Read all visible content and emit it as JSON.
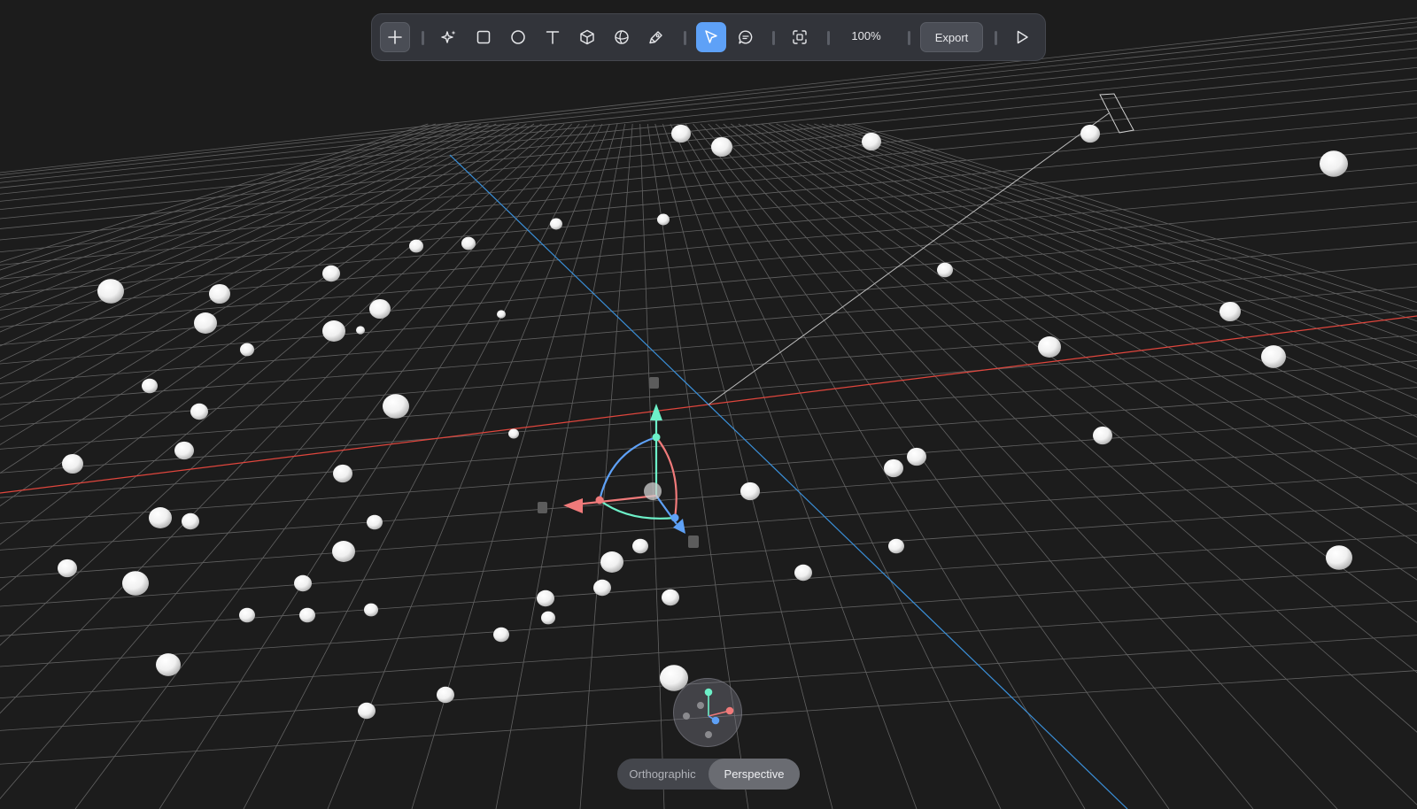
{
  "toolbar": {
    "tools": [
      {
        "name": "add",
        "icon": "plus-icon"
      },
      {
        "name": "ai-generate",
        "icon": "sparkles-icon"
      },
      {
        "name": "rectangle",
        "icon": "square-icon"
      },
      {
        "name": "ellipse",
        "icon": "circle-icon"
      },
      {
        "name": "text",
        "icon": "text-icon"
      },
      {
        "name": "cube",
        "icon": "cube-icon"
      },
      {
        "name": "sphere",
        "icon": "sphere-icon"
      },
      {
        "name": "pen",
        "icon": "pen-icon"
      },
      {
        "name": "select",
        "icon": "cursor-icon",
        "active": true
      },
      {
        "name": "comment",
        "icon": "comment-icon"
      },
      {
        "name": "frame",
        "icon": "frame-icon"
      },
      {
        "name": "play",
        "icon": "play-icon"
      }
    ],
    "zoom": "100%",
    "export_label": "Export"
  },
  "view_toggle": {
    "options": [
      "Orthographic",
      "Perspective"
    ],
    "selected": "Perspective"
  },
  "colors": {
    "background": "#1c1c1c",
    "grid": "#6f6f6f",
    "x_axis": "#e0463d",
    "z_axis": "#3a8fd8",
    "gizmo_x": "#f07a7a",
    "gizmo_y": "#6df0c8",
    "gizmo_z": "#5ea1f7",
    "accent": "#5ea1f7"
  }
}
